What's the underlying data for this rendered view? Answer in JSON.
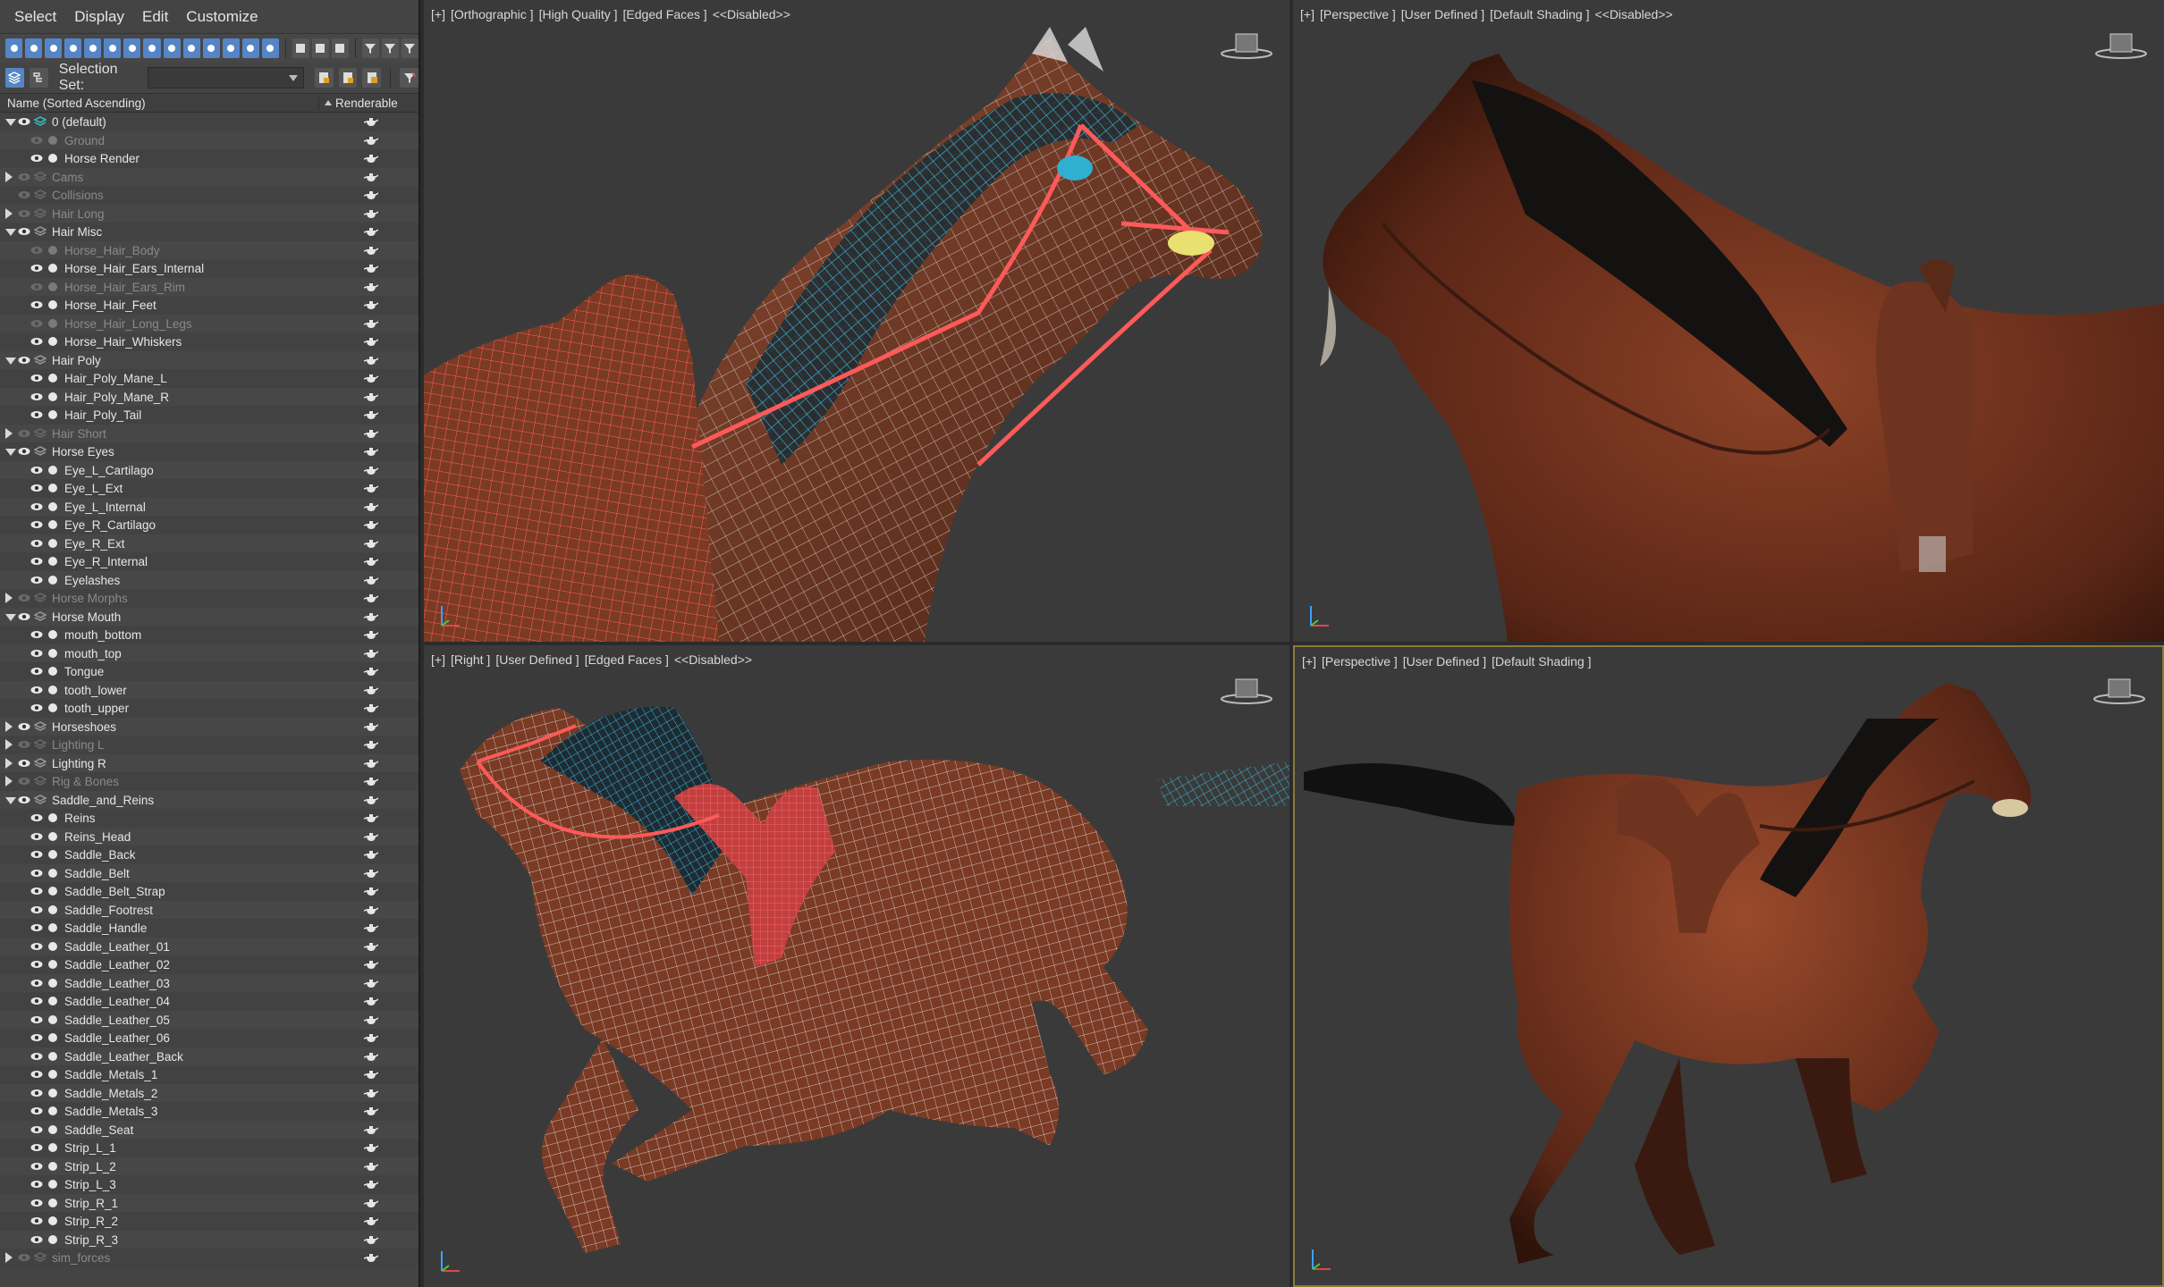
{
  "menu": [
    "Select",
    "Display",
    "Edit",
    "Customize"
  ],
  "selection_set": {
    "label": "Selection Set:",
    "value": ""
  },
  "columns": {
    "name": "Name (Sorted Ascending)",
    "renderable": "Renderable"
  },
  "layers": [
    {
      "label": "0 (default)",
      "level": 0,
      "expander": "open",
      "state": "bright",
      "eye": true,
      "icon": "layer-active"
    },
    {
      "label": "Ground",
      "level": 1,
      "state": "dim",
      "eye": false,
      "icon": "object"
    },
    {
      "label": "Horse Render",
      "level": 1,
      "state": "bright",
      "eye": true,
      "icon": "object"
    },
    {
      "label": "Cams",
      "level": 0,
      "expander": "closed",
      "state": "dim",
      "eye": false,
      "icon": "layer"
    },
    {
      "label": "Collisions",
      "level": 0,
      "expander": "",
      "state": "dim",
      "eye": false,
      "icon": "layer"
    },
    {
      "label": "Hair Long",
      "level": 0,
      "expander": "closed",
      "state": "dim",
      "eye": false,
      "icon": "layer"
    },
    {
      "label": "Hair Misc",
      "level": 0,
      "expander": "open",
      "state": "bright",
      "eye": true,
      "icon": "layer"
    },
    {
      "label": "Horse_Hair_Body",
      "level": 1,
      "state": "dim",
      "eye": false,
      "icon": "object"
    },
    {
      "label": "Horse_Hair_Ears_Internal",
      "level": 1,
      "state": "bright",
      "eye": true,
      "icon": "object"
    },
    {
      "label": "Horse_Hair_Ears_Rim",
      "level": 1,
      "state": "dim",
      "eye": false,
      "icon": "object"
    },
    {
      "label": "Horse_Hair_Feet",
      "level": 1,
      "state": "bright",
      "eye": true,
      "icon": "object"
    },
    {
      "label": "Horse_Hair_Long_Legs",
      "level": 1,
      "state": "dim",
      "eye": false,
      "icon": "object"
    },
    {
      "label": "Horse_Hair_Whiskers",
      "level": 1,
      "state": "bright",
      "eye": true,
      "icon": "object"
    },
    {
      "label": "Hair Poly",
      "level": 0,
      "expander": "open",
      "state": "bright",
      "eye": true,
      "icon": "layer"
    },
    {
      "label": "Hair_Poly_Mane_L",
      "level": 1,
      "state": "bright",
      "eye": true,
      "icon": "object"
    },
    {
      "label": "Hair_Poly_Mane_R",
      "level": 1,
      "state": "bright",
      "eye": true,
      "icon": "object"
    },
    {
      "label": "Hair_Poly_Tail",
      "level": 1,
      "state": "bright",
      "eye": true,
      "icon": "object"
    },
    {
      "label": "Hair Short",
      "level": 0,
      "expander": "closed",
      "state": "dim",
      "eye": false,
      "icon": "layer"
    },
    {
      "label": "Horse Eyes",
      "level": 0,
      "expander": "open",
      "state": "bright",
      "eye": true,
      "icon": "layer"
    },
    {
      "label": "Eye_L_Cartilago",
      "level": 1,
      "state": "bright",
      "eye": true,
      "icon": "object"
    },
    {
      "label": "Eye_L_Ext",
      "level": 1,
      "state": "bright",
      "eye": true,
      "icon": "object"
    },
    {
      "label": "Eye_L_Internal",
      "level": 1,
      "state": "bright",
      "eye": true,
      "icon": "object"
    },
    {
      "label": "Eye_R_Cartilago",
      "level": 1,
      "state": "bright",
      "eye": true,
      "icon": "object"
    },
    {
      "label": "Eye_R_Ext",
      "level": 1,
      "state": "bright",
      "eye": true,
      "icon": "object"
    },
    {
      "label": "Eye_R_Internal",
      "level": 1,
      "state": "bright",
      "eye": true,
      "icon": "object"
    },
    {
      "label": "Eyelashes",
      "level": 1,
      "state": "bright",
      "eye": true,
      "icon": "object"
    },
    {
      "label": "Horse Morphs",
      "level": 0,
      "expander": "closed",
      "state": "dim",
      "eye": false,
      "icon": "layer"
    },
    {
      "label": "Horse Mouth",
      "level": 0,
      "expander": "open",
      "state": "bright",
      "eye": true,
      "icon": "layer"
    },
    {
      "label": "mouth_bottom",
      "level": 1,
      "state": "bright",
      "eye": true,
      "icon": "object"
    },
    {
      "label": "mouth_top",
      "level": 1,
      "state": "bright",
      "eye": true,
      "icon": "object"
    },
    {
      "label": "Tongue",
      "level": 1,
      "state": "bright",
      "eye": true,
      "icon": "object"
    },
    {
      "label": "tooth_lower",
      "level": 1,
      "state": "bright",
      "eye": true,
      "icon": "object"
    },
    {
      "label": "tooth_upper",
      "level": 1,
      "state": "bright",
      "eye": true,
      "icon": "object"
    },
    {
      "label": "Horseshoes",
      "level": 0,
      "expander": "closed",
      "state": "bright",
      "eye": true,
      "icon": "layer"
    },
    {
      "label": "Lighting L",
      "level": 0,
      "expander": "closed",
      "state": "dim",
      "eye": false,
      "icon": "layer"
    },
    {
      "label": "Lighting R",
      "level": 0,
      "expander": "closed",
      "state": "bright",
      "eye": true,
      "icon": "layer"
    },
    {
      "label": "Rig & Bones",
      "level": 0,
      "expander": "closed",
      "state": "dim",
      "eye": false,
      "icon": "layer"
    },
    {
      "label": "Saddle_and_Reins",
      "level": 0,
      "expander": "open",
      "state": "bright",
      "eye": true,
      "icon": "layer"
    },
    {
      "label": "Reins",
      "level": 1,
      "state": "bright",
      "eye": true,
      "icon": "object"
    },
    {
      "label": "Reins_Head",
      "level": 1,
      "state": "bright",
      "eye": true,
      "icon": "object"
    },
    {
      "label": "Saddle_Back",
      "level": 1,
      "state": "bright",
      "eye": true,
      "icon": "object"
    },
    {
      "label": "Saddle_Belt",
      "level": 1,
      "state": "bright",
      "eye": true,
      "icon": "object"
    },
    {
      "label": "Saddle_Belt_Strap",
      "level": 1,
      "state": "bright",
      "eye": true,
      "icon": "object"
    },
    {
      "label": "Saddle_Footrest",
      "level": 1,
      "state": "bright",
      "eye": true,
      "icon": "object"
    },
    {
      "label": "Saddle_Handle",
      "level": 1,
      "state": "bright",
      "eye": true,
      "icon": "object"
    },
    {
      "label": "Saddle_Leather_01",
      "level": 1,
      "state": "bright",
      "eye": true,
      "icon": "object"
    },
    {
      "label": "Saddle_Leather_02",
      "level": 1,
      "state": "bright",
      "eye": true,
      "icon": "object"
    },
    {
      "label": "Saddle_Leather_03",
      "level": 1,
      "state": "bright",
      "eye": true,
      "icon": "object"
    },
    {
      "label": "Saddle_Leather_04",
      "level": 1,
      "state": "bright",
      "eye": true,
      "icon": "object"
    },
    {
      "label": "Saddle_Leather_05",
      "level": 1,
      "state": "bright",
      "eye": true,
      "icon": "object"
    },
    {
      "label": "Saddle_Leather_06",
      "level": 1,
      "state": "bright",
      "eye": true,
      "icon": "object"
    },
    {
      "label": "Saddle_Leather_Back",
      "level": 1,
      "state": "bright",
      "eye": true,
      "icon": "object"
    },
    {
      "label": "Saddle_Metals_1",
      "level": 1,
      "state": "bright",
      "eye": true,
      "icon": "object"
    },
    {
      "label": "Saddle_Metals_2",
      "level": 1,
      "state": "bright",
      "eye": true,
      "icon": "object"
    },
    {
      "label": "Saddle_Metals_3",
      "level": 1,
      "state": "bright",
      "eye": true,
      "icon": "object"
    },
    {
      "label": "Saddle_Seat",
      "level": 1,
      "state": "bright",
      "eye": true,
      "icon": "object"
    },
    {
      "label": "Strip_L_1",
      "level": 1,
      "state": "bright",
      "eye": true,
      "icon": "object"
    },
    {
      "label": "Strip_L_2",
      "level": 1,
      "state": "bright",
      "eye": true,
      "icon": "object"
    },
    {
      "label": "Strip_L_3",
      "level": 1,
      "state": "bright",
      "eye": true,
      "icon": "object"
    },
    {
      "label": "Strip_R_1",
      "level": 1,
      "state": "bright",
      "eye": true,
      "icon": "object"
    },
    {
      "label": "Strip_R_2",
      "level": 1,
      "state": "bright",
      "eye": true,
      "icon": "object"
    },
    {
      "label": "Strip_R_3",
      "level": 1,
      "state": "bright",
      "eye": true,
      "icon": "object"
    },
    {
      "label": "sim_forces",
      "level": 0,
      "expander": "closed",
      "state": "dim",
      "eye": false,
      "icon": "layer"
    }
  ],
  "viewports": [
    {
      "id": "vp1",
      "labels": [
        "[+]",
        "[Orthographic ]",
        "[High Quality ]",
        "[Edged Faces ]",
        "<<Disabled>>"
      ]
    },
    {
      "id": "vp2",
      "labels": [
        "[+]",
        "[Perspective ]",
        "[User Defined ]",
        "[Default Shading ]",
        "<<Disabled>>"
      ]
    },
    {
      "id": "vp3",
      "labels": [
        "[+]",
        "[Right ]",
        "[User Defined ]",
        "[Edged Faces ]",
        "<<Disabled>>"
      ]
    },
    {
      "id": "vp4",
      "labels": [
        "[+]",
        "[Perspective ]",
        "[User Defined ]",
        "[Default Shading ]"
      ]
    }
  ],
  "colors": {
    "accent_blue": "#5585c6",
    "horse_brown": "#7a3a24",
    "wire_white": "#e8e8e8",
    "wire_red": "#e04848",
    "wire_cyan": "#39b8d8",
    "active_border": "#8c7a3a",
    "bg_viewport": "#3a3a3a"
  }
}
